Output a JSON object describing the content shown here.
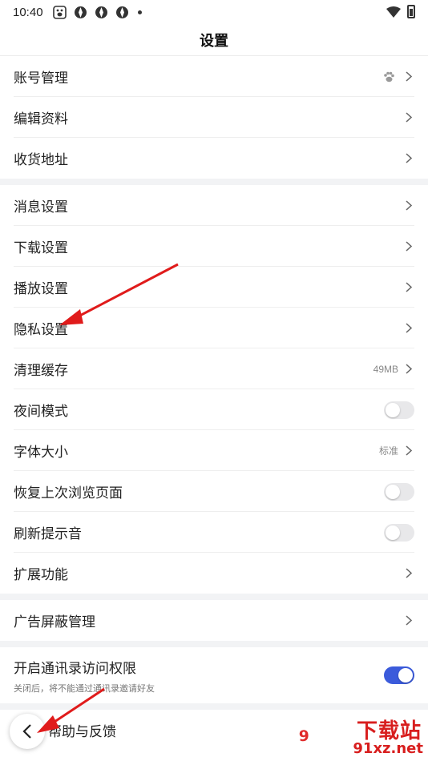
{
  "status_bar": {
    "time": "10:40"
  },
  "header": {
    "title": "设置"
  },
  "groups": [
    [
      {
        "label": "账号管理",
        "accessory": "chevron",
        "leading_icon": "baidu-paw-icon"
      },
      {
        "label": "编辑资料",
        "accessory": "chevron"
      },
      {
        "label": "收货地址",
        "accessory": "chevron"
      }
    ],
    [
      {
        "label": "消息设置",
        "accessory": "chevron"
      },
      {
        "label": "下载设置",
        "accessory": "chevron"
      },
      {
        "label": "播放设置",
        "accessory": "chevron"
      },
      {
        "label": "隐私设置",
        "accessory": "chevron"
      },
      {
        "label": "清理缓存",
        "value": "49MB",
        "accessory": "chevron"
      },
      {
        "label": "夜间模式",
        "accessory": "toggle",
        "on": false
      },
      {
        "label": "字体大小",
        "value": "标准",
        "accessory": "chevron"
      },
      {
        "label": "恢复上次浏览页面",
        "accessory": "toggle",
        "on": false
      },
      {
        "label": "刷新提示音",
        "accessory": "toggle",
        "on": false
      },
      {
        "label": "扩展功能",
        "accessory": "chevron"
      }
    ],
    [
      {
        "label": "广告屏蔽管理",
        "accessory": "chevron"
      }
    ],
    [
      {
        "label": "开启通讯录访问权限",
        "sub": "关闭后，将不能通过通讯录邀请好友",
        "accessory": "toggle",
        "on": true
      }
    ],
    [
      {
        "label": "帮助与反馈",
        "accessory": "chevron"
      }
    ]
  ],
  "watermark": {
    "text": "下载站",
    "url": "91xz.net"
  },
  "colors": {
    "accent": "#3b5bdb",
    "annotation_arrow": "#e01b1b",
    "divider": "#eeeeee",
    "group_gap": "#f2f3f5"
  }
}
